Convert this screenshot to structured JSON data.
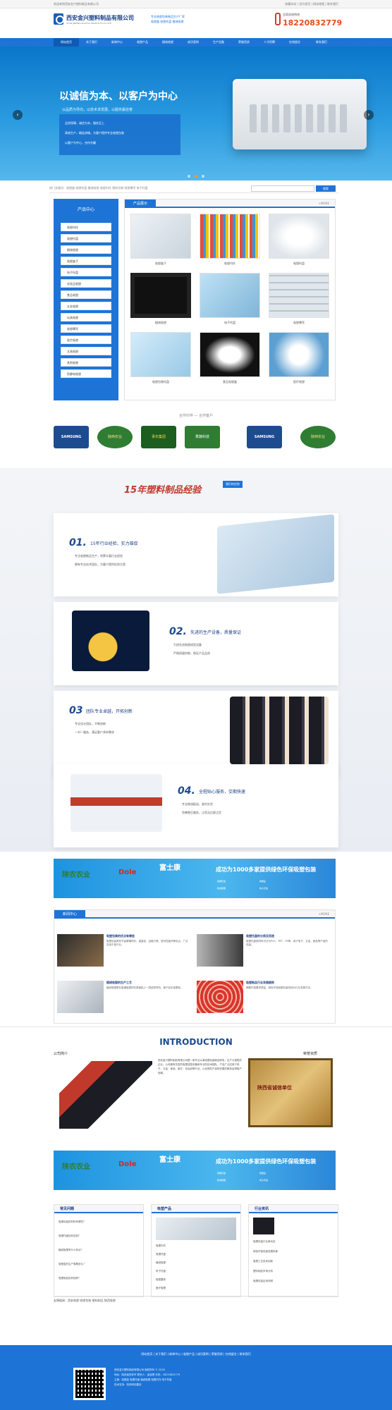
{
  "topbar": {
    "left": "欢迎来到西安金兴塑料制品有限公司",
    "right": "收藏本站 | 设为首页 | 网站地图 | 联系我们"
  },
  "header": {
    "company_cn": "西安金兴塑料制品有限公司",
    "company_en": "XI'AN JINXING PLASTIC PRODUCTS CO.,LTD",
    "slogan_1": "专业吸塑包装制品生产厂家",
    "slogan_2": "吸塑盒 吸塑托盘 植绒吸塑",
    "hotline_label": "全国咨询热线",
    "hotline_number": "18220832779"
  },
  "nav": [
    "网站首页",
    "关于我们",
    "新闻中心",
    "吸塑产品",
    "植绒吸塑",
    "成功案例",
    "生产设备",
    "荣誉资质",
    "人才招聘",
    "在线留言",
    "联系我们"
  ],
  "banner": {
    "title": "以诚信为本、以客户为中心",
    "subtitle": "以品质为导向，以技术求发展，以服务赢信誉",
    "points": [
      "品质保障，诚信为本，服务至上",
      "高效生产，精益求精，为客户提供专业吸塑包装",
      "以客户为中心，合作共赢"
    ]
  },
  "search": {
    "hotwords": "热门关键词：吸塑盒 吸塑托盘 植绒吸塑 吸塑内托 塑料包装 吸塑罩壳 电子托盘",
    "button": "搜索"
  },
  "sidebar": {
    "title": "产品中心",
    "items": [
      "吸塑内托",
      "吸塑托盘",
      "植绒吸塑",
      "吸塑盒子",
      "电子托盘",
      "化妆品吸塑",
      "食品吸塑",
      "五金吸塑",
      "玩具吸塑",
      "吸塑罩壳",
      "医疗吸塑",
      "文具吸塑",
      "其他吸塑",
      "防静电吸塑"
    ]
  },
  "products": {
    "title": "产品展示",
    "more": "+MORE",
    "items": [
      "吸塑盒子",
      "吸塑内托",
      "吸塑托盘",
      "植绒吸塑",
      "电子托盘",
      "吸塑罩壳",
      "吸塑包装托盘",
      "食品吸塑盒",
      "医疗吸塑"
    ]
  },
  "partners": {
    "title": "合作伙伴 — 合作客户",
    "items": [
      "SAMSUNG",
      "陕西农业",
      "事农集团",
      "果蔬科技",
      "SAMSUNG",
      "陕西农业"
    ]
  },
  "experience": {
    "title": "15年塑料制品经验",
    "badge": "我们的优势",
    "adv": [
      {
        "num": "01.",
        "head": "15年行业经验，实力雄厚",
        "lines": [
          "专注吸塑制品生产，积累丰富行业经验",
          "拥有专业技术团队，为客户提供优质方案"
        ]
      },
      {
        "num": "02.",
        "head": "先进的生产设备，质量保证",
        "lines": [
          "引进先进吸塑成型设备",
          "严格质量控制，保证产品品质"
        ]
      },
      {
        "num": "03",
        "head": "团队专业卓越，开拓创新",
        "lines": [
          "专业设计团队，不断创新",
          "一对一服务，满足客户多样需求"
        ]
      },
      {
        "num": "04.",
        "head": "全程贴心服务，交期快速",
        "lines": [
          "专业物流配送，准时交货",
          "完善售后服务，让您无后顾之忧"
        ]
      }
    ]
  },
  "ad": {
    "brand_1": "陕农农业",
    "brand_2": "Dole",
    "brand_3": "富士康",
    "headline": "成功为1000多家提供绿色环保吸塑包装",
    "notes": [
      "吸塑托盘",
      "吸塑盒",
      "植绒吸塑",
      "电子托盘"
    ]
  },
  "news": {
    "title": "新闻中心",
    "more": "+MORE",
    "items": [
      {
        "title": "吸塑包装的优点有哪些",
        "desc": "吸塑包装具有节省原辅材料、重量轻、运输方便、密封性能好等优点，广泛应用于各行业。"
      },
      {
        "title": "吸塑托盘的分类及用途",
        "desc": "吸塑托盘按材料可分为PVC、PET、PS等，用于电子、五金、食品等产品的包装。"
      },
      {
        "title": "植绒吸塑的生产工艺",
        "desc": "植绒吸塑是在普通吸塑材料表面粘上一层绒质材料，使产品手感柔软。"
      },
      {
        "title": "吸塑制品行业发展趋势",
        "desc": "随着环保要求提高，绿色环保吸塑包装将成为行业发展方向。"
      }
    ]
  },
  "intro": {
    "title": "INTRODUCTION",
    "left_label": "公司简介",
    "right_label": "荣誉资质",
    "text": "西安金兴塑料制品有限公司是一家专业从事吸塑包装制品研发、生产与销售的企业。公司拥有先进的吸塑成型设备和专业的技术团队，产品广泛应用于电子、五金、食品、医疗、化妆品等行业，以优质的产品和完善的服务赢得客户信赖。",
    "cert": "陕西省诚信单位"
  },
  "bottom": {
    "panels": [
      {
        "title": "常见问题",
        "lines": [
          "吸塑包装的材料有哪些？",
          "吸塑托盘如何定制？",
          "植绒吸塑有什么特点？",
          "吸塑盒的生产周期多久？",
          "吸塑制品如何保养？"
        ]
      },
      {
        "title": "吸塑产品",
        "lines": [
          "吸塑内托",
          "吸塑托盘",
          "植绒吸塑",
          "电子托盘",
          "吸塑罩壳",
          "医疗吸塑"
        ]
      },
      {
        "title": "行业资讯",
        "lines": [
          "吸塑包装行业新动态",
          "绿色环保包装发展前景",
          "吸塑工艺技术创新",
          "塑料制品市场分析",
          "吸塑包装应用领域"
        ]
      }
    ]
  },
  "links": "友情链接：西安吸塑 吸塑包装 塑料制品 陕西吸塑",
  "footer": {
    "nav": "网站首页 | 关于我们 | 新闻中心 | 吸塑产品 | 成功案例 | 荣誉资质 | 在线留言 | 联系我们",
    "lines": [
      "西安金兴塑料制品有限公司 版权所有 © 2018",
      "地址：陕西省西安市 联系人：金经理 手机：18220832779",
      "主营：吸塑盒 吸塑托盘 植绒吸塑 吸塑内托 电子托盘",
      "技术支持：西安网站建设"
    ]
  }
}
